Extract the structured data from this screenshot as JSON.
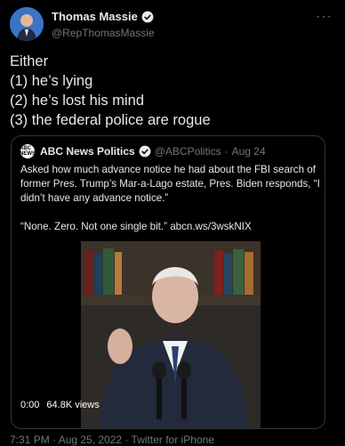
{
  "author": {
    "name": "Thomas Massie",
    "handle": "@RepThomasMassie"
  },
  "tweet_lines": [
    "Either",
    "(1) he’s lying",
    "(2) he’s lost his mind",
    "(3) the federal police are rogue"
  ],
  "quote": {
    "logo_text": "ABC NEWS",
    "name": "ABC News Politics",
    "handle": "@ABCPolitics",
    "separator": "·",
    "date": "Aug 24",
    "paragraph1": [
      "Asked how much advance notice he had about the FBI search of",
      "former Pres. Trump’s Mar-a-Lago estate, Pres. Biden responds, “I",
      "didn’t have any advance notice.”"
    ],
    "paragraph2": "“None. Zero. Not one single bit.” abcn.ws/3wskNIX",
    "video_time": "0:00",
    "views": "64.8K views"
  },
  "footer": "7:31 PM · Aug 25, 2022 · Twitter for iPhone",
  "colors": {
    "background": "#000000",
    "text": "#e7e9ea",
    "secondary": "#71767b",
    "verified": "#1d9bf0",
    "border": "#333639"
  }
}
